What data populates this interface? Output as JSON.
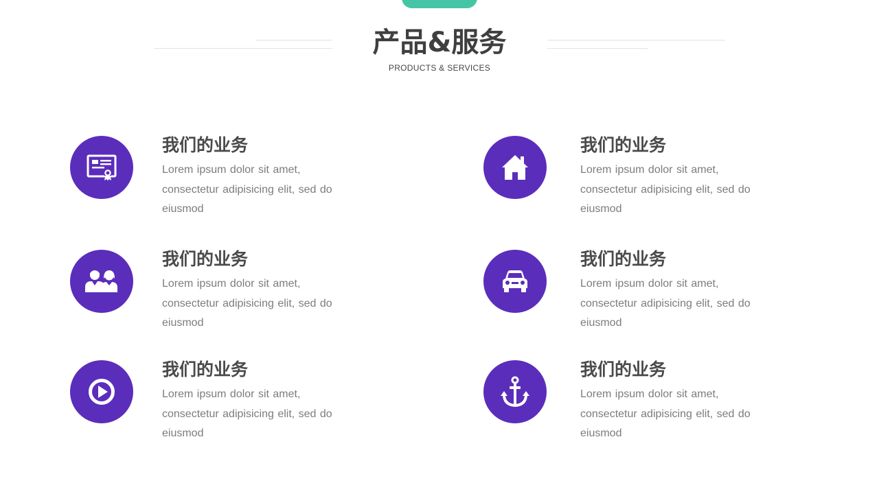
{
  "header": {
    "title": "产品&服务",
    "subtitle": "PRODUCTS & SERVICES"
  },
  "colors": {
    "accent_purple": "#5b2dbb",
    "accent_teal": "#46c5a6",
    "heading_text": "#4a4a4a",
    "body_text": "#7c7c7c"
  },
  "services": [
    {
      "icon": "certificate-icon",
      "title": "我们的业务",
      "description": "Lorem ipsum dolor sit amet, consectetur adipisicing elit, sed do eiusmod"
    },
    {
      "icon": "house-icon",
      "title": "我们的业务",
      "description": "Lorem ipsum dolor sit amet, consectetur adipisicing elit, sed do eiusmod"
    },
    {
      "icon": "people-icon",
      "title": "我们的业务",
      "description": "Lorem ipsum dolor sit amet, consectetur adipisicing elit, sed do eiusmod"
    },
    {
      "icon": "car-icon",
      "title": "我们的业务",
      "description": "Lorem ipsum dolor sit amet, consectetur adipisicing elit, sed do eiusmod"
    },
    {
      "icon": "play-icon",
      "title": "我们的业务",
      "description": "Lorem ipsum dolor sit amet, consectetur adipisicing elit, sed do eiusmod"
    },
    {
      "icon": "anchor-icon",
      "title": "我们的业务",
      "description": "Lorem ipsum dolor sit amet, consectetur adipisicing elit, sed do eiusmod"
    }
  ]
}
